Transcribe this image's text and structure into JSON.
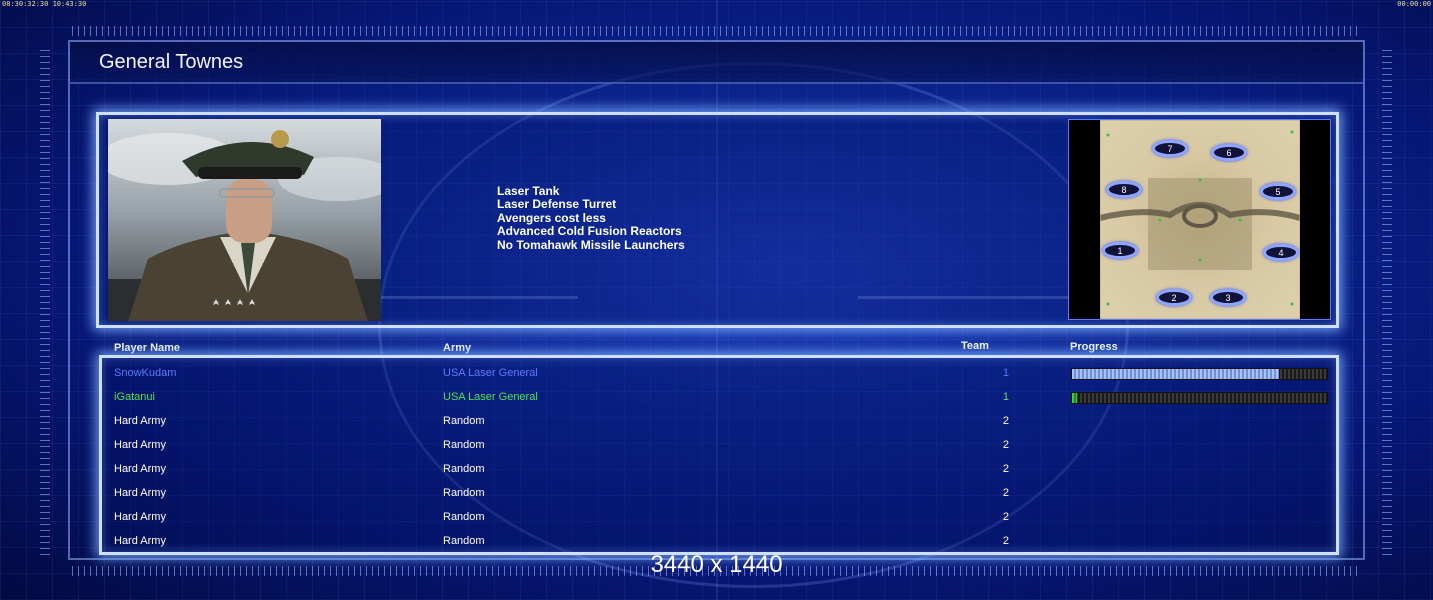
{
  "clock": {
    "left": "08:30:32:30 10:43:30",
    "right": "00:00:00"
  },
  "general": {
    "title": "General Townes",
    "features": [
      "Laser Tank",
      "Laser Defense Turret",
      "Avengers cost less",
      "Advanced Cold Fusion Reactors",
      "No Tomahawk Missile Launchers"
    ]
  },
  "map": {
    "start_positions": [
      "1",
      "2",
      "3",
      "4",
      "5",
      "6",
      "7",
      "8"
    ]
  },
  "table": {
    "headers": {
      "name": "Player Name",
      "army": "Army",
      "team": "Team",
      "progress": "Progress"
    },
    "rows": [
      {
        "name": "SnowKudam",
        "army": "USA Laser General",
        "team": "1",
        "color": "#5a7bff",
        "progress": 0.81
      },
      {
        "name": "iGatanui",
        "army": "USA Laser General",
        "team": "1",
        "color": "#4ee44e",
        "progress": 0.02
      },
      {
        "name": "Hard Army",
        "army": "Random",
        "team": "2",
        "color": "#ffffff"
      },
      {
        "name": "Hard Army",
        "army": "Random",
        "team": "2",
        "color": "#ffffff"
      },
      {
        "name": "Hard Army",
        "army": "Random",
        "team": "2",
        "color": "#ffffff"
      },
      {
        "name": "Hard Army",
        "army": "Random",
        "team": "2",
        "color": "#ffffff"
      },
      {
        "name": "Hard Army",
        "army": "Random",
        "team": "2",
        "color": "#ffffff"
      },
      {
        "name": "Hard Army",
        "army": "Random",
        "team": "2",
        "color": "#ffffff"
      }
    ]
  },
  "resolution_label": "3440 x 1440"
}
